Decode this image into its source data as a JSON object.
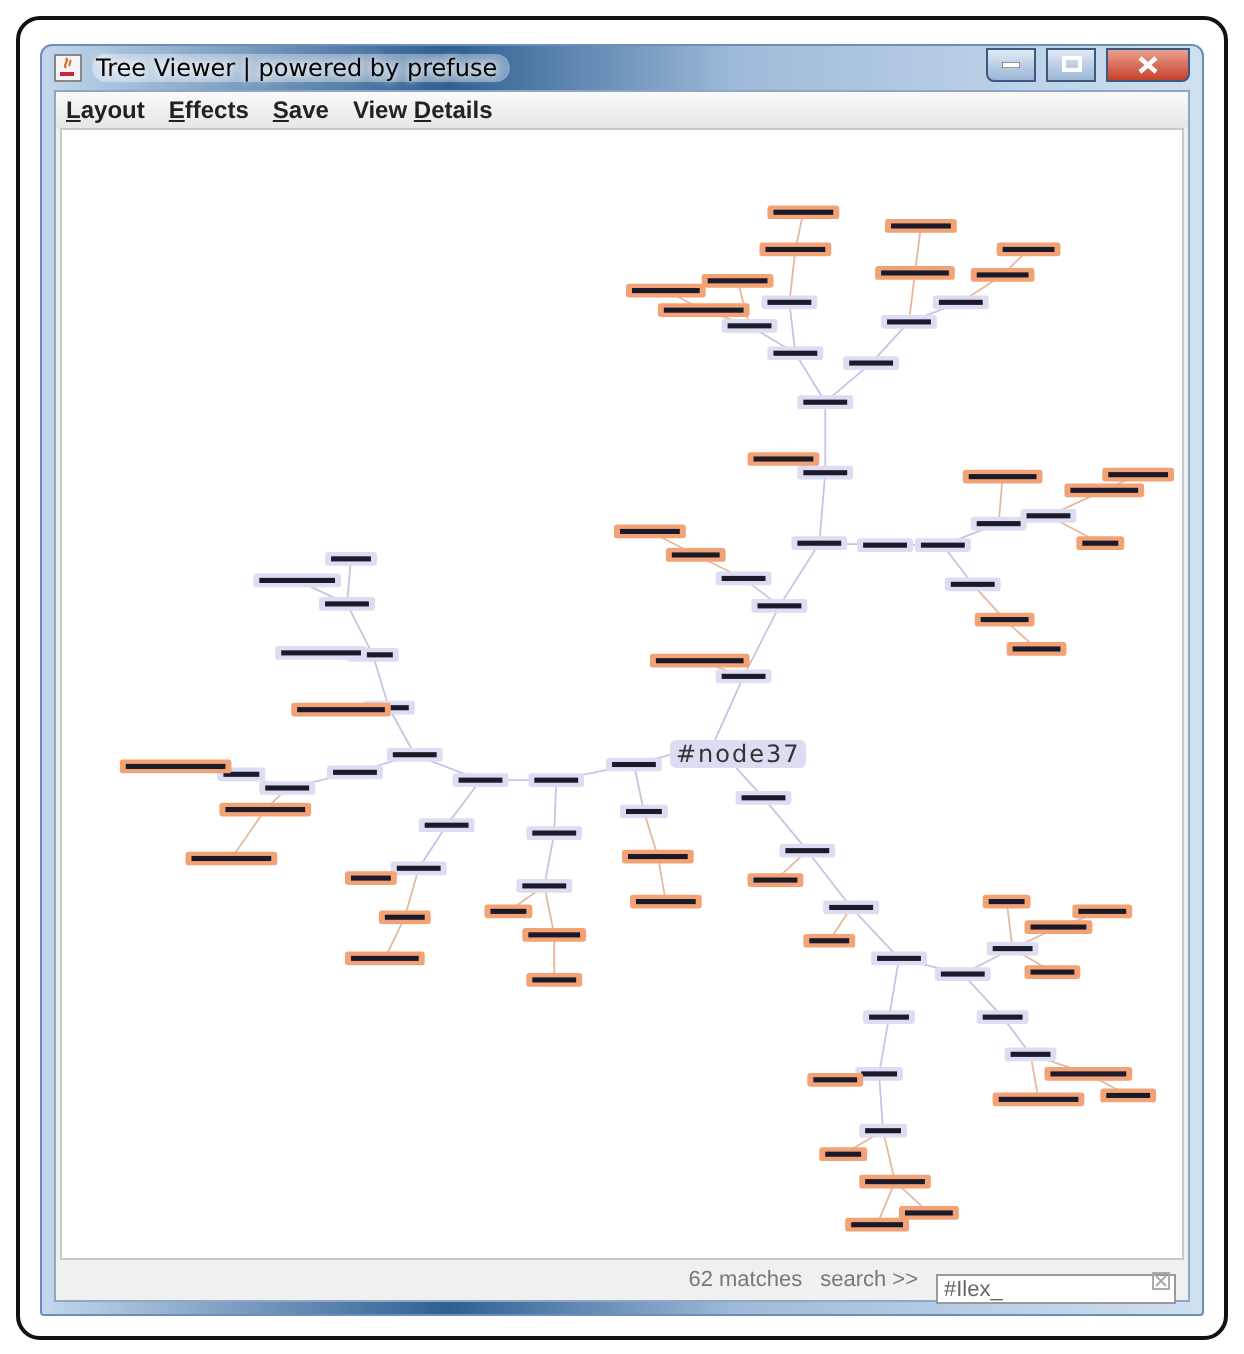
{
  "window": {
    "title": "Tree Viewer | powered by prefuse"
  },
  "menu": [
    {
      "label": "Layout",
      "mnemonic_underlined": true
    },
    {
      "label": "Effects",
      "mnemonic_underlined": true
    },
    {
      "label": "Save",
      "mnemonic_underlined": true
    },
    {
      "label": "View Details",
      "mnemonic_underlined": true
    }
  ],
  "graph": {
    "focus_label": "#node37"
  },
  "status": {
    "matches": "62 matches",
    "search_label": "search >>",
    "search_value": "#Ilex_"
  }
}
